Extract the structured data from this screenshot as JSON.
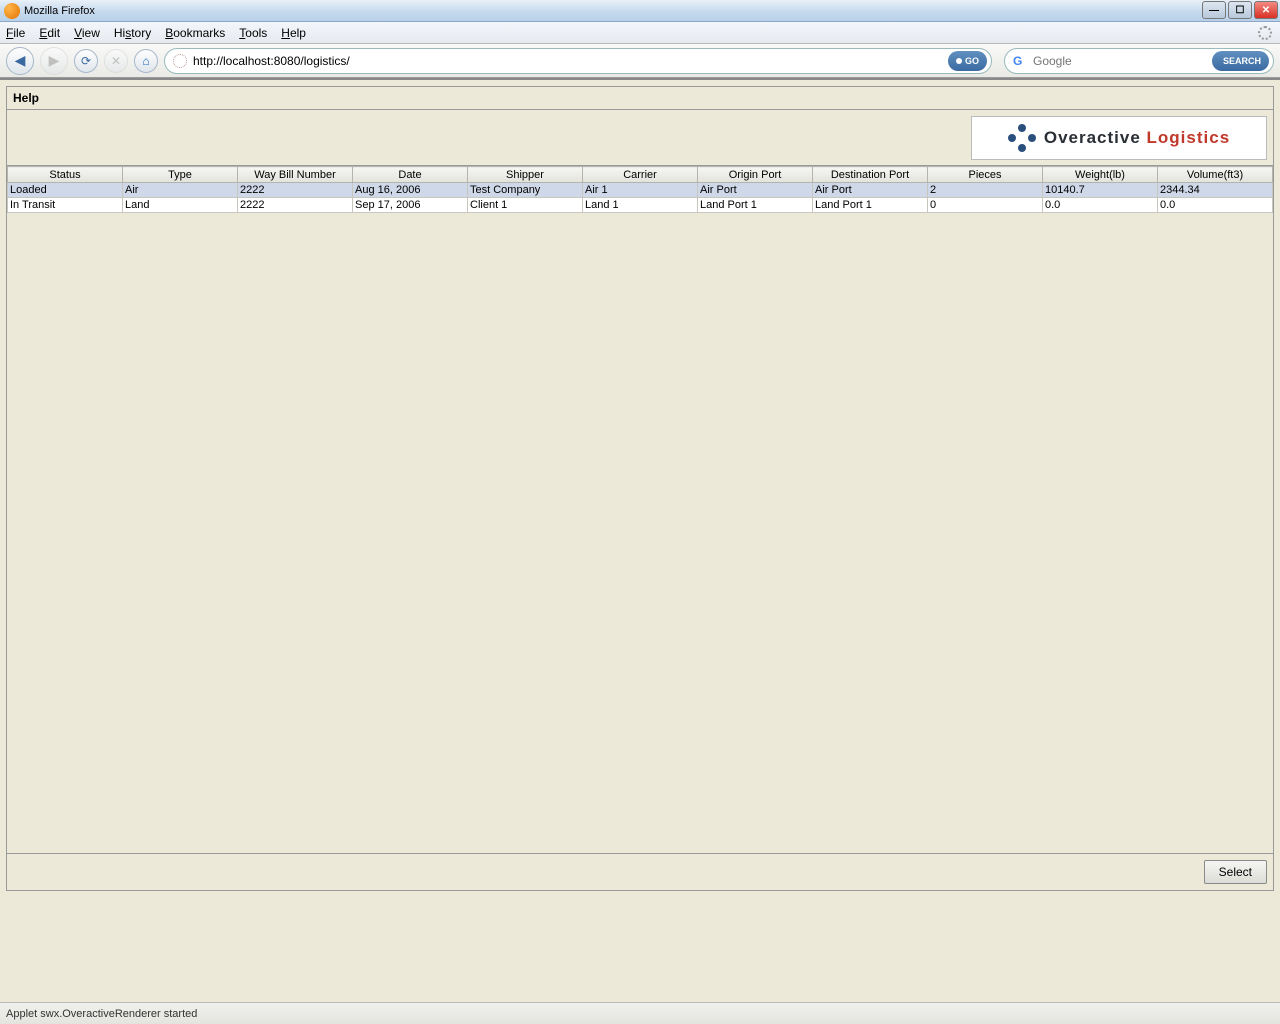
{
  "window": {
    "title": "Mozilla Firefox"
  },
  "menubar": {
    "file": "File",
    "edit": "Edit",
    "view": "View",
    "history": "History",
    "bookmarks": "Bookmarks",
    "tools": "Tools",
    "help": "Help"
  },
  "toolbar": {
    "url": "http://localhost:8080/logistics/",
    "go_label": "GO",
    "search_placeholder": "Google",
    "search_label": "SEARCH"
  },
  "panel": {
    "help_label": "Help",
    "logo_overactive": "Overactive",
    "logo_logistics": "Logistics",
    "select_label": "Select"
  },
  "grid": {
    "columns": [
      "Status",
      "Type",
      "Way Bill Number",
      "Date",
      "Shipper",
      "Carrier",
      "Origin Port",
      "Destination Port",
      "Pieces",
      "Weight(lb)",
      "Volume(ft3)"
    ],
    "rows": [
      {
        "selected": true,
        "cells": [
          "Loaded",
          "Air",
          "2222",
          "Aug 16, 2006",
          "Test Company",
          "Air 1",
          "Air Port",
          "Air Port",
          "2",
          "10140.7",
          "2344.34"
        ]
      },
      {
        "selected": false,
        "cells": [
          "In Transit",
          "Land",
          "2222",
          "Sep 17, 2006",
          "Client 1",
          "Land 1",
          "Land Port 1",
          "Land Port 1",
          "0",
          "0.0",
          "0.0"
        ]
      }
    ]
  },
  "statusbar": {
    "text": "Applet swx.OveractiveRenderer started"
  }
}
